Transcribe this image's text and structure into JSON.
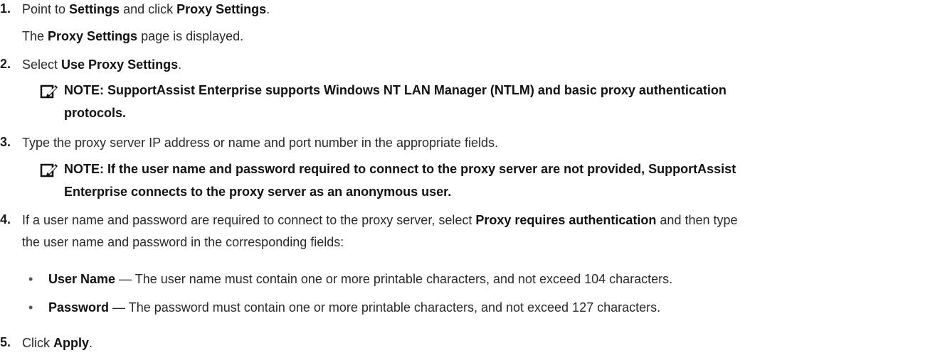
{
  "steps": [
    {
      "number": "1.",
      "pre": "Point to ",
      "bold1": "Settings",
      "mid": " and click ",
      "bold2": "Proxy Settings",
      "post": ".",
      "sub_pre": "The ",
      "sub_bold": "Proxy Settings",
      "sub_post": " page is displayed."
    },
    {
      "number": "2.",
      "pre": "Select ",
      "bold1": "Use Proxy Settings",
      "post": "."
    },
    {
      "number": "3.",
      "text": "Type the proxy server IP address or name and port number in the appropriate fields."
    },
    {
      "number": "4.",
      "pre": "If a user name and password are required to connect to the proxy server, select ",
      "bold1": "Proxy requires authentication",
      "post": " and then type",
      "line2": "the user name and password in the corresponding fields:"
    },
    {
      "number": "5.",
      "pre": "Click ",
      "bold1": "Apply",
      "post": "."
    }
  ],
  "notes": [
    {
      "line1": "NOTE: SupportAssist Enterprise supports Windows NT LAN Manager (NTLM) and basic proxy authentication",
      "line2": "protocols."
    },
    {
      "line1": "NOTE: If the user name and password required to connect to the proxy server are not provided, SupportAssist",
      "line2": "Enterprise connects to the proxy server as an anonymous user."
    }
  ],
  "bullets": [
    {
      "marker": "•",
      "bold": "User Name",
      "text": " — The user name must contain one or more printable characters, and not exceed 104 characters."
    },
    {
      "marker": "•",
      "bold": "Password",
      "text": " — The password must contain one or more printable characters, and not exceed 127 characters."
    }
  ],
  "icons": {
    "note": "pencil-note-icon"
  }
}
